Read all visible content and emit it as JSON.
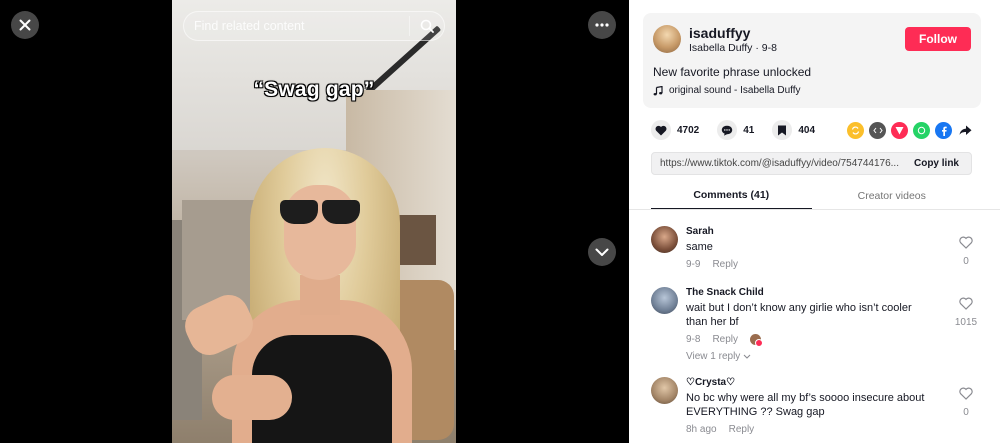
{
  "search": {
    "placeholder": "Find related content"
  },
  "video": {
    "caption": "“Swag gap”"
  },
  "author": {
    "username": "isaduffyy",
    "nickname": "Isabella Duffy",
    "date": "9-8",
    "follow_label": "Follow",
    "description": "New favorite phrase unlocked",
    "music": "original sound - Isabella Duffy"
  },
  "actions": {
    "likes": "4702",
    "comments": "41",
    "saves": "404"
  },
  "share_icons": [
    "repost",
    "embed",
    "send-to-friends",
    "whatsapp",
    "facebook",
    "share-arrow"
  ],
  "link": {
    "url": "https://www.tiktok.com/@isaduffyy/video/754744176...",
    "copy_label": "Copy link"
  },
  "tabs": [
    {
      "label": "Comments (41)",
      "active": true
    },
    {
      "label": "Creator videos",
      "active": false
    }
  ],
  "comments": [
    {
      "name": "Sarah",
      "text": "same",
      "date": "9-9",
      "reply_label": "Reply",
      "likes": "0"
    },
    {
      "name": "The Snack Child",
      "text": "wait but I don’t know any girlie who isn’t cooler than her bf",
      "date": "9-8",
      "reply_label": "Reply",
      "likes": "1015",
      "view_replies": "View 1 reply"
    },
    {
      "name": "♡Crysta♡",
      "text": "No bc why were all my bf’s soooo insecure about EVERYTHING ?? Swag gap",
      "date": "8h ago",
      "reply_label": "Reply",
      "likes": "0"
    }
  ],
  "colors": {
    "follow": "#fe2c55",
    "text": "#161823",
    "muted": "#8a8b91"
  }
}
